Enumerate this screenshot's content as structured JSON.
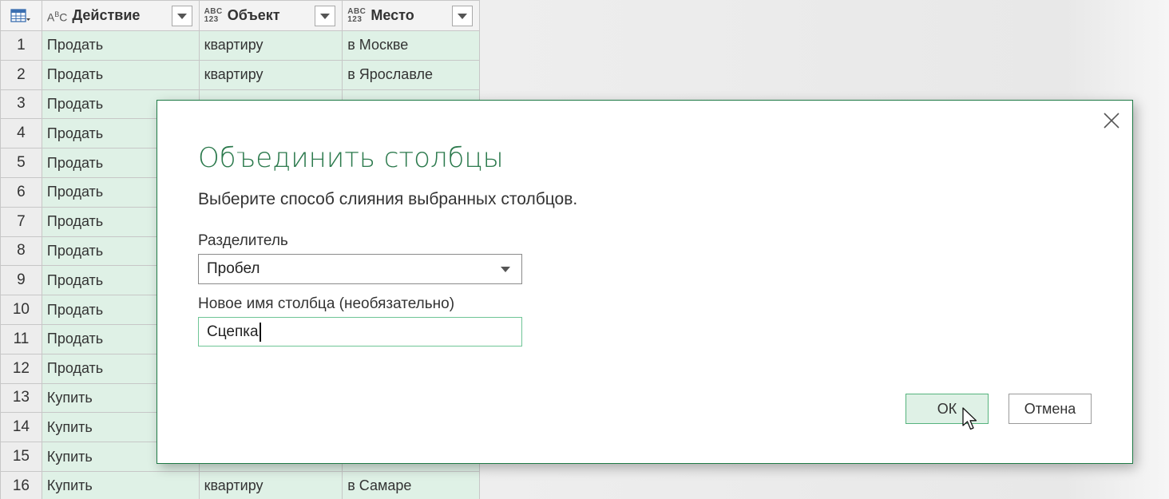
{
  "grid": {
    "columns": [
      {
        "name": "Действие",
        "type_icon": "ABC"
      },
      {
        "name": "Объект",
        "type_icon": "ABC 123"
      },
      {
        "name": "Место",
        "type_icon": "ABC 123"
      }
    ],
    "rows": [
      {
        "n": "1",
        "action": "Продать",
        "object": "квартиру",
        "place": "в Москве"
      },
      {
        "n": "2",
        "action": "Продать",
        "object": "квартиру",
        "place": "в Ярославле"
      },
      {
        "n": "3",
        "action": "Продать",
        "object": "",
        "place": ""
      },
      {
        "n": "4",
        "action": "Продать",
        "object": "",
        "place": ""
      },
      {
        "n": "5",
        "action": "Продать",
        "object": "",
        "place": ""
      },
      {
        "n": "6",
        "action": "Продать",
        "object": "",
        "place": ""
      },
      {
        "n": "7",
        "action": "Продать",
        "object": "",
        "place": ""
      },
      {
        "n": "8",
        "action": "Продать",
        "object": "",
        "place": ""
      },
      {
        "n": "9",
        "action": "Продать",
        "object": "",
        "place": ""
      },
      {
        "n": "10",
        "action": "Продать",
        "object": "",
        "place": ""
      },
      {
        "n": "11",
        "action": "Продать",
        "object": "",
        "place": ""
      },
      {
        "n": "12",
        "action": "Продать",
        "object": "",
        "place": ""
      },
      {
        "n": "13",
        "action": "Купить",
        "object": "",
        "place": ""
      },
      {
        "n": "14",
        "action": "Купить",
        "object": "",
        "place": ""
      },
      {
        "n": "15",
        "action": "Купить",
        "object": "",
        "place": ""
      },
      {
        "n": "16",
        "action": "Купить",
        "object": "квартиру",
        "place": "в Самаре"
      }
    ]
  },
  "dialog": {
    "title": "Объединить столбцы",
    "subtitle": "Выберите способ слияния выбранных столбцов.",
    "separator_label": "Разделитель",
    "separator_value": "Пробел",
    "new_name_label": "Новое имя столбца (необязательно)",
    "new_name_value": "Сцепка",
    "ok_label": "ОК",
    "cancel_label": "Отмена",
    "accent_color": "#2c7a4d"
  },
  "icons": {
    "table_menu": "table-icon",
    "close": "close-icon",
    "dropdown": "chevron-down-icon",
    "cursor": "mouse-pointer-icon"
  }
}
